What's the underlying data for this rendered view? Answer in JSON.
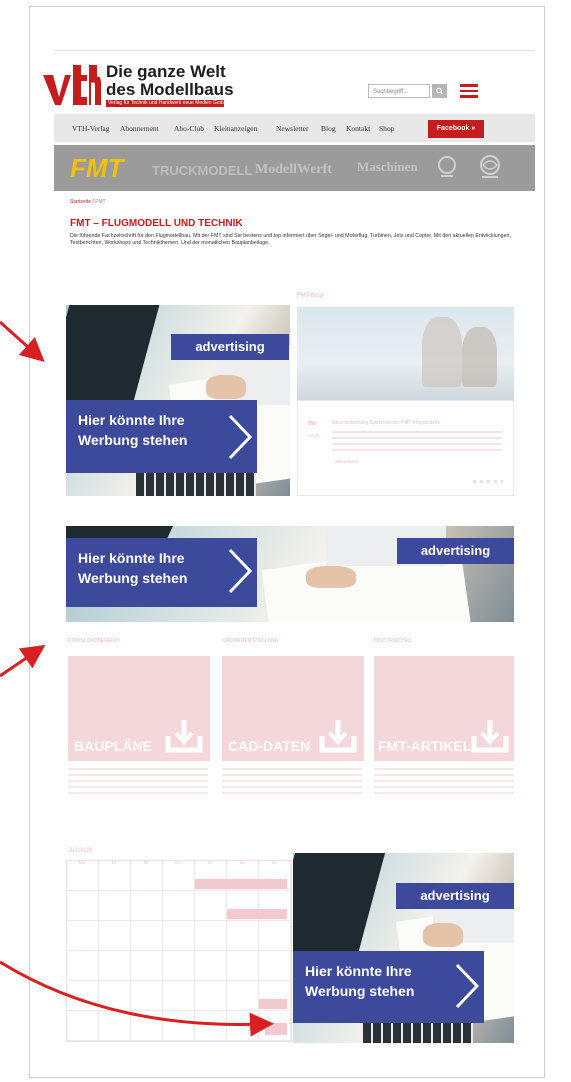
{
  "logo": {
    "brand": "vth",
    "line1": "Die ganze Welt",
    "line2": "des Modellbaus",
    "tagline": "Verlag für Technik und Handwerk neue Medien GmbH"
  },
  "search": {
    "placeholder": "Suchbegriff..."
  },
  "nav": {
    "items": [
      "VTH-Verlag",
      "Abonnement",
      "Abo-Club",
      "Kleinanzeigen",
      "Newsletter",
      "Blog",
      "Kontakt",
      "Shop"
    ],
    "facebook": "Facebook »"
  },
  "brands": {
    "fmt": "FMT",
    "truck": "TRUCKMODELL",
    "werft": "ModellWerft",
    "maschinen": "Maschinen"
  },
  "breadcrumb": {
    "home": "Startseite",
    "current": "FMT"
  },
  "page": {
    "title": "FMT – FLUGMODELL UND TECHNIK",
    "intro": "Die führende Fachzeitschrift für den Flugmodellbau. Mit der FMT sind Sie bestens und top informiert über Segel- und Motorflug, Turbinen, Jets und Copter. Mit den aktuellen Entwicklungen, Testberichten, Workshops und Technikthemen. Und der monatlichen Bauplanbeilage."
  },
  "ads": {
    "label": "advertising",
    "text_line1": "Hier könnte Ihre",
    "text_line2": "Werbung stehen"
  },
  "blog": {
    "heading": "FMT-Blog",
    "date_day": "Mo",
    "date_year": "2018",
    "post_title": "Neuerscheinung Spektrum der FMT-Flugmodelle",
    "more": "› Weiterlesen"
  },
  "sections": {
    "downloads": "DOWNLOADBEREICH",
    "cad": "CAD-BEREITSTELLUNG",
    "artikel": "HISTORISCHES",
    "bauplane": "BAUPLÄNE",
    "cad_daten": "CAD-DATEN",
    "fmt_artikel": "FMT-ARTIKEL"
  },
  "calendar": {
    "month": "Juli 2020",
    "days": [
      "Mo",
      "Di",
      "Mi",
      "Do",
      "Fr",
      "Sa",
      "So"
    ]
  },
  "colors": {
    "red": "#c51d1d",
    "ad_blue": "#3d4a9b",
    "arrow_red": "#d92020"
  }
}
